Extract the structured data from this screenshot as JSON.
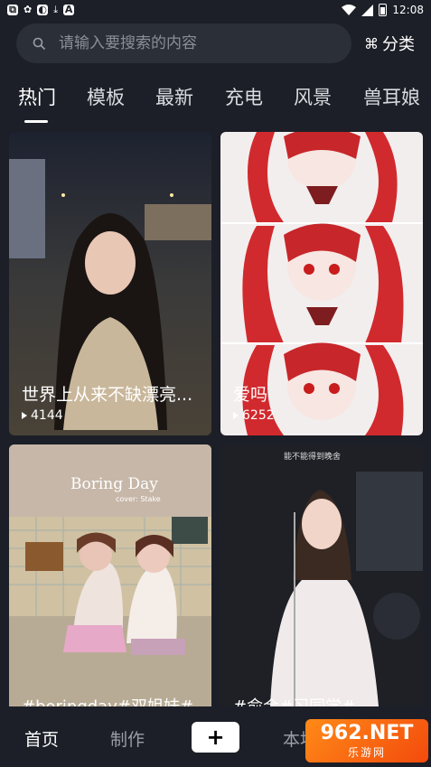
{
  "status_bar": {
    "time": "12:08",
    "left_icons": [
      "app-icon-1",
      "bug-icon",
      "app-icon-2",
      "download-icon",
      "a-icon"
    ]
  },
  "search": {
    "placeholder": "请输入要搜索的内容",
    "category_label": "分类"
  },
  "tabs": [
    {
      "label": "热门",
      "active": true
    },
    {
      "label": "模板",
      "active": false
    },
    {
      "label": "最新",
      "active": false
    },
    {
      "label": "充电",
      "active": false
    },
    {
      "label": "风景",
      "active": false
    },
    {
      "label": "兽耳娘",
      "active": false
    }
  ],
  "cards": [
    {
      "title": "世界上从来不缺漂亮...",
      "views": "4144"
    },
    {
      "title": "爱吗",
      "views": "6252"
    },
    {
      "title": "#boringday#双姐妹#",
      "views": ""
    },
    {
      "title": "#俞合#习同学#",
      "views": ""
    }
  ],
  "card3_overlay": {
    "title": "Boring Day",
    "subtitle": "cover: Stake"
  },
  "card4_overlay": {
    "caption": "能不能得到晚舍"
  },
  "bottom_nav": {
    "home": "首页",
    "make": "制作",
    "add": "+",
    "local": "本地"
  },
  "watermark": {
    "line1": "962.NET",
    "line2": "乐游网"
  },
  "colors": {
    "background": "#1c1f27",
    "search_bg": "#2b2f38",
    "watermark": "#f36a12"
  }
}
